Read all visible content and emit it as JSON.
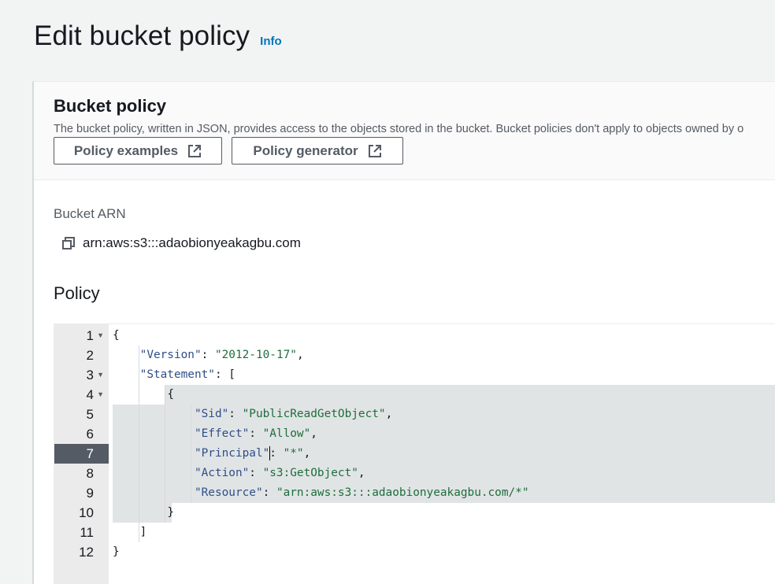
{
  "header": {
    "title": "Edit bucket policy",
    "info_label": "Info"
  },
  "bucket_policy": {
    "title": "Bucket policy",
    "description": "The bucket policy, written in JSON, provides access to the objects stored in the bucket. Bucket policies don't apply to objects owned by o",
    "buttons": {
      "examples_label": "Policy examples",
      "generator_label": "Policy generator"
    },
    "icons": {
      "external_link": "external-link-icon",
      "copy": "copy-icon",
      "fold": "fold-arrow-icon"
    }
  },
  "arn": {
    "label": "Bucket ARN",
    "value": "arn:aws:s3:::adaobionyeakagbu.com"
  },
  "policy": {
    "heading": "Policy",
    "active_line": 7,
    "line_numbers": [
      "1",
      "2",
      "3",
      "4",
      "5",
      "6",
      "7",
      "8",
      "9",
      "10",
      "11",
      "12"
    ],
    "code": {
      "l1_open": "{",
      "l2_key": "\"Version\"",
      "l2_sep": ": ",
      "l2_val": "\"2012-10-17\"",
      "l2_end": ",",
      "l3_key": "\"Statement\"",
      "l3_sep": ": [",
      "l4_open": "{",
      "l5_key": "\"Sid\"",
      "l5_sep": ": ",
      "l5_val": "\"PublicReadGetObject\"",
      "l5_end": ",",
      "l6_key": "\"Effect\"",
      "l6_sep": ": ",
      "l6_val": "\"Allow\"",
      "l6_end": ",",
      "l7_key": "\"Principal\"",
      "l7_sep": ": ",
      "l7_val": "\"*\"",
      "l7_end": ",",
      "l8_key": "\"Action\"",
      "l8_sep": ": ",
      "l8_val": "\"s3:GetObject\"",
      "l8_end": ",",
      "l9_key": "\"Resource\"",
      "l9_sep": ": ",
      "l9_val": "\"arn:aws:s3:::adaobionyeakagbu.com/*\"",
      "l10_close": "}",
      "l11_close": "]",
      "l12_close": "}"
    }
  },
  "colors": {
    "link": "#0073bb",
    "json_key": "#2e4f88",
    "json_string": "#1d6e3c",
    "active_gutter": "#545b64",
    "selection": "#e1e4e5"
  }
}
